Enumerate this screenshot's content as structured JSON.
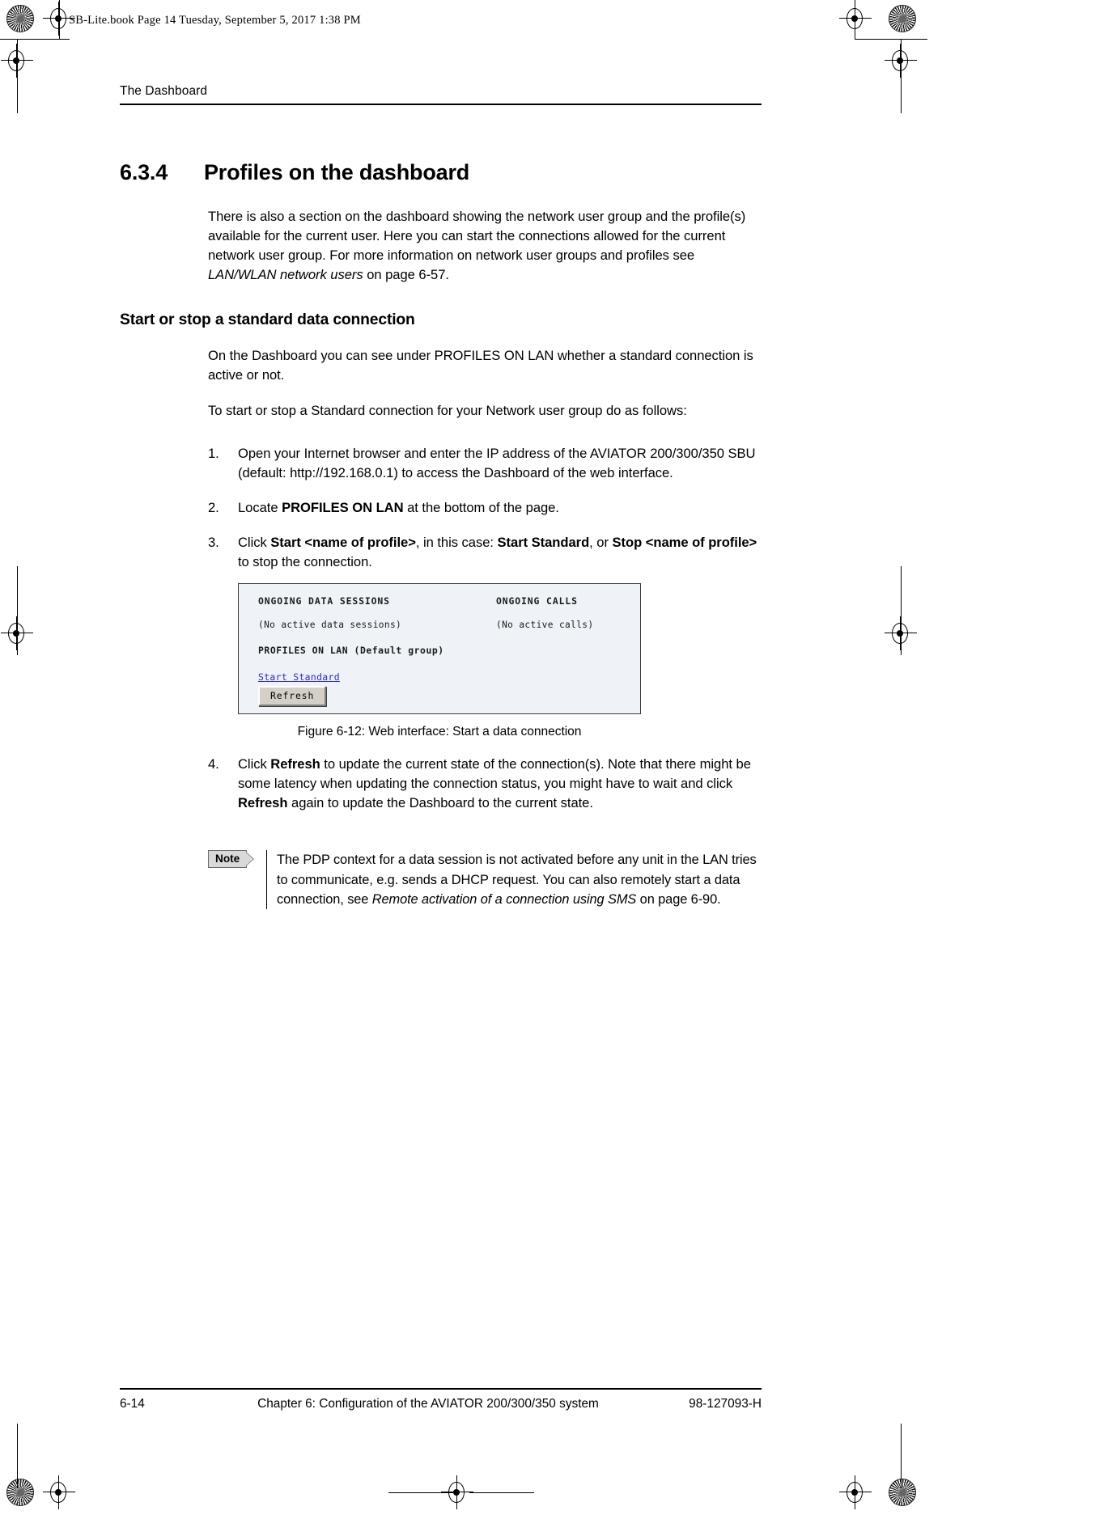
{
  "print_marks": {
    "file_stamp": "SB-Lite.book  Page 14  Tuesday, September 5, 2017  1:38 PM"
  },
  "header": {
    "running_head": "The Dashboard"
  },
  "section": {
    "number": "6.3.4",
    "title": "Profiles on the dashboard",
    "intro": "There is also a section on the dashboard showing the network user group and the profile(s) available for the current user. Here you can start the connections allowed for the current network user group. For more information on network user groups and profiles see ",
    "intro_italic": "LAN/WLAN network users",
    "intro_tail": " on page 6-57."
  },
  "subsection": {
    "title": "Start or stop a standard data connection",
    "para1": "On the Dashboard you can see under PROFILES ON LAN whether a standard connection is active or not.",
    "para2": "To start or stop a Standard connection for your Network user group do as follows:"
  },
  "steps": [
    {
      "marker": "1.",
      "parts": [
        {
          "text": "Open your Internet browser and enter the IP address of the AVIATOR 200/300/350 SBU (default: http://192.168.0.1) to access the Dashboard of the web interface.",
          "style": "normal"
        }
      ]
    },
    {
      "marker": "2.",
      "parts": [
        {
          "text": "Locate ",
          "style": "normal"
        },
        {
          "text": "PROFILES ON LAN",
          "style": "bold"
        },
        {
          "text": " at the bottom of the page.",
          "style": "normal"
        }
      ]
    },
    {
      "marker": "3.",
      "parts": [
        {
          "text": "Click ",
          "style": "normal"
        },
        {
          "text": "Start <name of profile>",
          "style": "bold"
        },
        {
          "text": ", in this case: ",
          "style": "normal"
        },
        {
          "text": "Start Standard",
          "style": "bold"
        },
        {
          "text": ", or ",
          "style": "normal"
        },
        {
          "text": "Stop <name of profile>",
          "style": "bold"
        },
        {
          "text": " to stop the connection.",
          "style": "normal"
        }
      ]
    },
    {
      "marker": "4.",
      "parts": [
        {
          "text": "Click ",
          "style": "normal"
        },
        {
          "text": "Refresh",
          "style": "bold"
        },
        {
          "text": " to update the current state of the connection(s). Note that there might be some latency when updating the connection status, you might have to wait and click ",
          "style": "normal"
        },
        {
          "text": "Refresh",
          "style": "bold"
        },
        {
          "text": " again to update the Dashboard to the current state.",
          "style": "normal"
        }
      ]
    }
  ],
  "figure": {
    "caption": "Figure 6-12: Web interface: Start a data connection",
    "webshot": {
      "heading_left": "ONGOING DATA SESSIONS",
      "heading_right": "ONGOING CALLS",
      "value_left": "(No active data sessions)",
      "value_right": "(No active calls)",
      "profiles_label": "PROFILES ON LAN",
      "profiles_group": "(Default group)",
      "start_link": "Start Standard",
      "refresh_button": "Refresh",
      "link_color": "#2929d6",
      "background_color": "#eff3f7",
      "button_face_color": "#d4d0c8"
    }
  },
  "note": {
    "label": "Note",
    "text_before": "The PDP context for a data session is not activated before any unit in the LAN tries to communicate, e.g. sends a DHCP request. You can also remotely start a data connection, see ",
    "text_italic": "Remote activation of a connection using SMS",
    "text_after": " on page 6-90."
  },
  "footer": {
    "page_number": "6-14",
    "chapter_title": "Chapter 6:  Configuration of the AVIATOR 200/300/350 system",
    "doc_number": "98-127093-H"
  }
}
